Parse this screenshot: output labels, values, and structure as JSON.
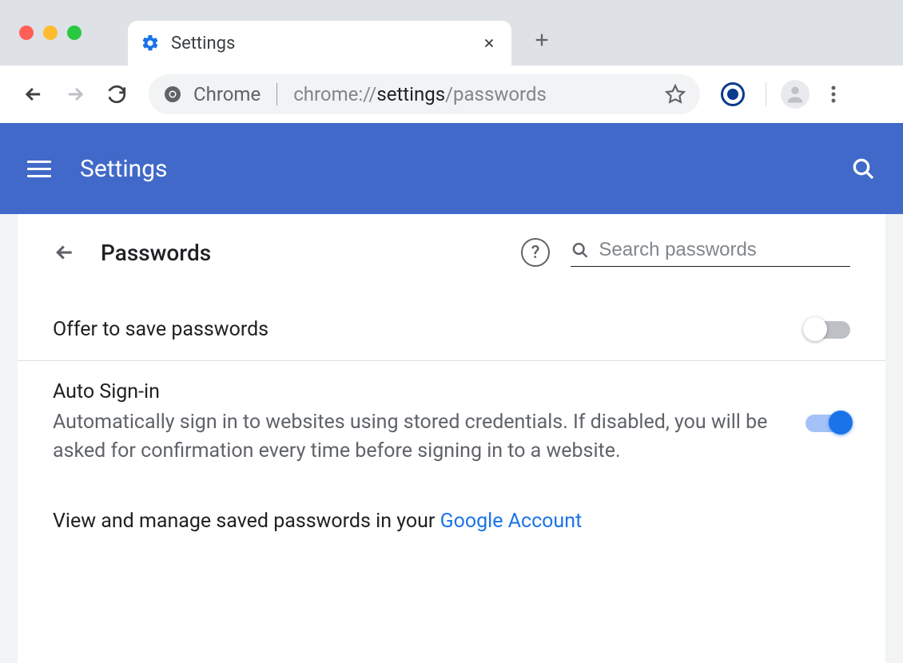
{
  "window": {
    "tab_title": "Settings"
  },
  "toolbar": {
    "omnibox_label": "Chrome",
    "url_prefix": "chrome://",
    "url_strong": "settings",
    "url_suffix": "/passwords"
  },
  "appbar": {
    "title": "Settings"
  },
  "page": {
    "title": "Passwords",
    "search_placeholder": "Search passwords",
    "rows": {
      "offer_save": {
        "title": "Offer to save passwords",
        "enabled": false
      },
      "auto_signin": {
        "title": "Auto Sign-in",
        "description": "Automatically sign in to websites using stored credentials. If disabled, you will be asked for confirmation every time before signing in to a website.",
        "enabled": true
      }
    },
    "manage_text": "View and manage saved passwords in your ",
    "manage_link": "Google Account"
  }
}
